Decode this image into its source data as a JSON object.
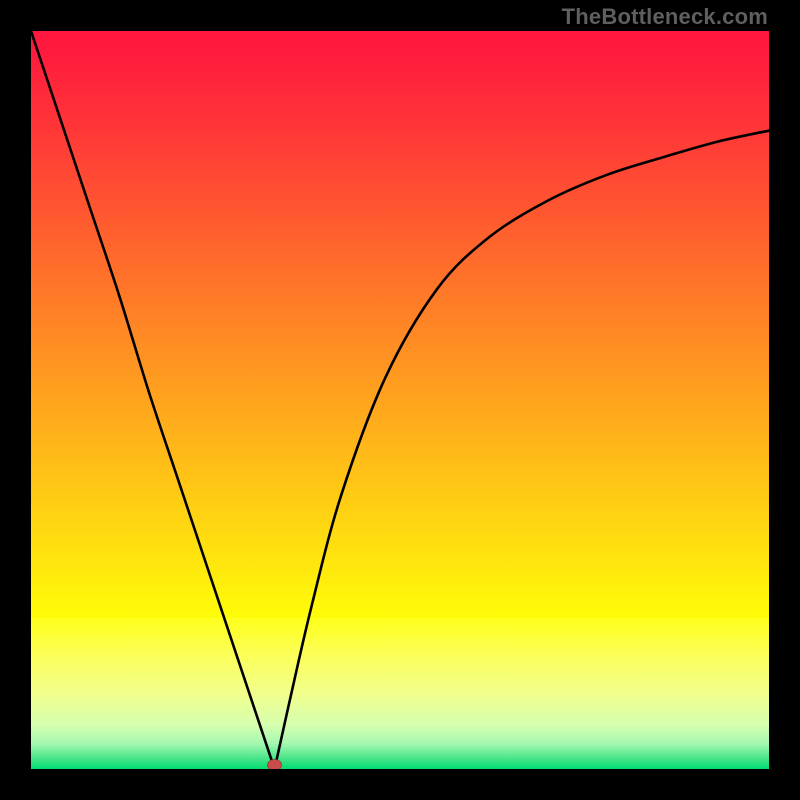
{
  "watermark": "TheBottleneck.com",
  "chart_data": {
    "type": "line",
    "title": "",
    "xlabel": "",
    "ylabel": "",
    "xlim": [
      0,
      100
    ],
    "ylim": [
      0,
      100
    ],
    "optimum_x": 33,
    "gradient_stops": [
      {
        "offset": 0.0,
        "color": "#ff163e"
      },
      {
        "offset": 0.035,
        "color": "#ff1d3d"
      },
      {
        "offset": 0.07,
        "color": "#ff263b"
      },
      {
        "offset": 0.105,
        "color": "#ff2f39"
      },
      {
        "offset": 0.14,
        "color": "#ff3937"
      },
      {
        "offset": 0.175,
        "color": "#ff4335"
      },
      {
        "offset": 0.21,
        "color": "#ff4d32"
      },
      {
        "offset": 0.245,
        "color": "#ff5730"
      },
      {
        "offset": 0.28,
        "color": "#ff622d"
      },
      {
        "offset": 0.315,
        "color": "#ff6c2b"
      },
      {
        "offset": 0.35,
        "color": "#ff7728"
      },
      {
        "offset": 0.385,
        "color": "#ff8126"
      },
      {
        "offset": 0.42,
        "color": "#ff8c23"
      },
      {
        "offset": 0.455,
        "color": "#ff9621"
      },
      {
        "offset": 0.49,
        "color": "#ffa11e"
      },
      {
        "offset": 0.525,
        "color": "#ffab1c"
      },
      {
        "offset": 0.56,
        "color": "#ffb619"
      },
      {
        "offset": 0.595,
        "color": "#ffc017"
      },
      {
        "offset": 0.63,
        "color": "#ffcb14"
      },
      {
        "offset": 0.665,
        "color": "#ffd512"
      },
      {
        "offset": 0.7,
        "color": "#ffe00f"
      },
      {
        "offset": 0.735,
        "color": "#ffea0d"
      },
      {
        "offset": 0.77,
        "color": "#fff50a"
      },
      {
        "offset": 0.794,
        "color": "#fffc08"
      },
      {
        "offset": 0.795,
        "color": "#feff1a"
      },
      {
        "offset": 0.85,
        "color": "#fbff5e"
      },
      {
        "offset": 0.9,
        "color": "#f0ff8e"
      },
      {
        "offset": 0.94,
        "color": "#d6ffaf"
      },
      {
        "offset": 0.965,
        "color": "#a6f8b0"
      },
      {
        "offset": 0.982,
        "color": "#5ae890"
      },
      {
        "offset": 1.0,
        "color": "#00dc71"
      }
    ],
    "left_branch": {
      "x": [
        0,
        4,
        8,
        12,
        16,
        20,
        24,
        28,
        31,
        33
      ],
      "y": [
        100,
        88,
        76,
        64,
        51,
        39,
        27,
        15,
        6,
        0
      ]
    },
    "right_branch": {
      "x": [
        33,
        35,
        38,
        42,
        48,
        55,
        62,
        70,
        78,
        86,
        93,
        100
      ],
      "y": [
        0,
        9,
        22,
        37,
        53,
        65,
        72,
        77,
        80.5,
        83,
        85,
        86.5
      ]
    },
    "marker": {
      "x": 33,
      "y": 0,
      "color": "#c94b4b"
    }
  }
}
